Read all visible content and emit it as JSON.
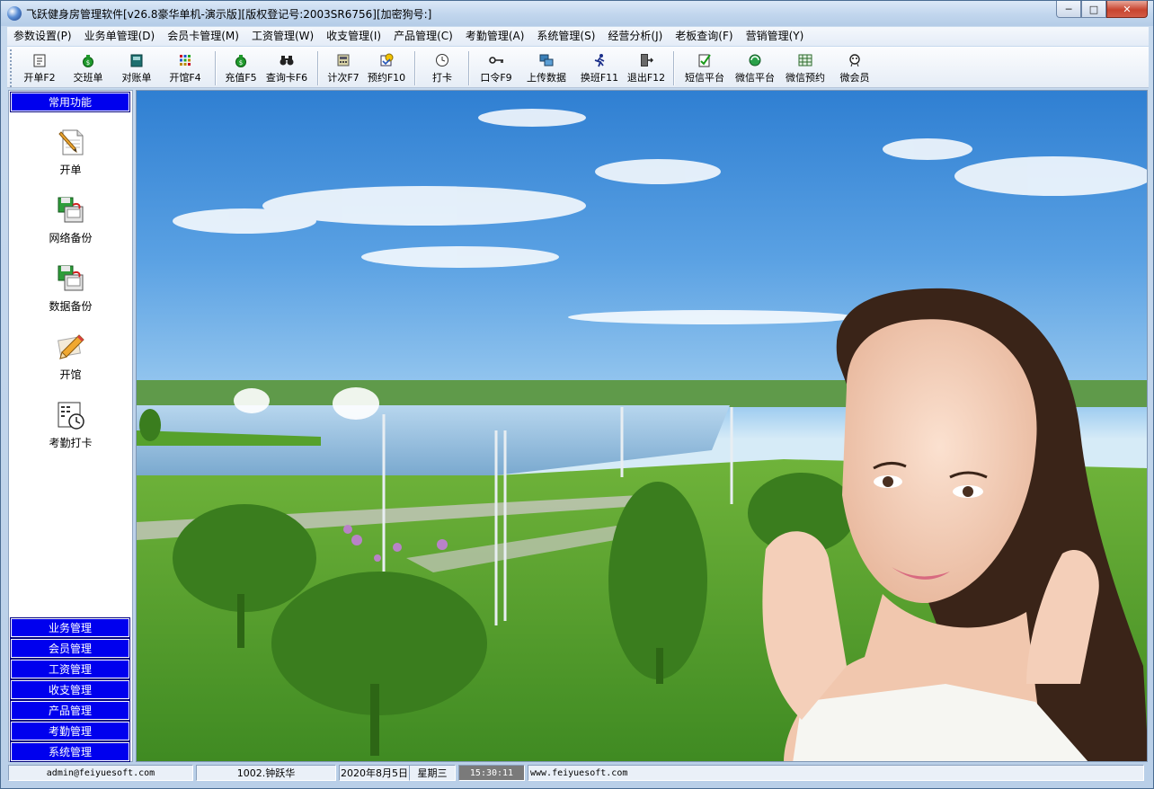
{
  "window": {
    "title": "飞跃健身房管理软件[v26.8豪华单机-演示版][版权登记号:2003SR6756][加密狗号:]"
  },
  "menu": [
    {
      "label": "参数设置(P)"
    },
    {
      "label": "业务单管理(D)"
    },
    {
      "label": "会员卡管理(M)"
    },
    {
      "label": "工资管理(W)"
    },
    {
      "label": "收支管理(I)"
    },
    {
      "label": "产品管理(C)"
    },
    {
      "label": "考勤管理(A)"
    },
    {
      "label": "系统管理(S)"
    },
    {
      "label": "经营分析(J)"
    },
    {
      "label": "老板查询(F)"
    },
    {
      "label": "营销管理(Y)"
    }
  ],
  "toolbar": {
    "open_bill": "开单F2",
    "shift_handover": "交班单",
    "reconcile": "对账单",
    "open_venue": "开馆F4",
    "recharge": "充值F5",
    "query_card": "查询卡F6",
    "count_times": "计次F7",
    "reserve": "预约F10",
    "clock_in": "打卡",
    "password": "口令F9",
    "upload_data": "上传数据",
    "switch_shift": "换班F11",
    "exit": "退出F12",
    "sms_platform": "短信平台",
    "wechat_platform": "微信平台",
    "wechat_reserve": "微信预约",
    "micro_member": "微会员"
  },
  "sidebar": {
    "header": "常用功能",
    "shortcuts": [
      {
        "label": "开单",
        "icon": "pencil-paper-icon"
      },
      {
        "label": "网络备份",
        "icon": "network-backup-icon"
      },
      {
        "label": "数据备份",
        "icon": "data-backup-icon"
      },
      {
        "label": "开馆",
        "icon": "pencil-icon"
      },
      {
        "label": "考勤打卡",
        "icon": "clock-card-icon"
      }
    ],
    "groups": [
      {
        "label": "业务管理"
      },
      {
        "label": "会员管理"
      },
      {
        "label": "工资管理"
      },
      {
        "label": "收支管理"
      },
      {
        "label": "产品管理"
      },
      {
        "label": "考勤管理"
      },
      {
        "label": "系统管理"
      }
    ]
  },
  "status": {
    "user_email": "admin@feiyuesoft.com",
    "operator": "1002.钟跃华",
    "date": "2020年8月5日",
    "weekday": "星期三",
    "time": "15:30:11",
    "website": "www.feiyuesoft.com"
  },
  "colors": {
    "sidebar_blue": "#0000ee",
    "sky_top": "#2f7fd2",
    "grass": "#4f9a2a"
  }
}
